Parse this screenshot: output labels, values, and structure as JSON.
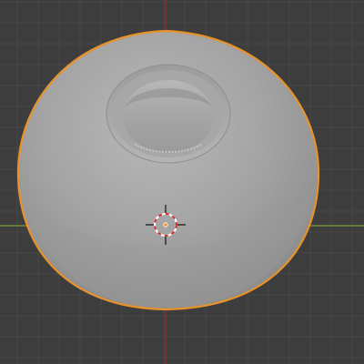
{
  "viewport": {
    "background_color": "#3d3d3d",
    "grid_color_minor": "#474747",
    "grid_color_major": "#4a4a4a",
    "x_axis_color": "#8a3a3a",
    "y_axis_color": "#7a9a3a",
    "z_axis_color": "#9b2c34"
  },
  "object": {
    "shape": "dome-with-center-hole",
    "shade_color": "#a0a0a0",
    "highlight_color": "#b6b6b6",
    "selection_outline_color": "#e8922a",
    "selected": true
  },
  "cursor_3d": {
    "icon": "3d-cursor-icon",
    "ring_colors": [
      "#ffffff",
      "#d32f2f"
    ]
  }
}
